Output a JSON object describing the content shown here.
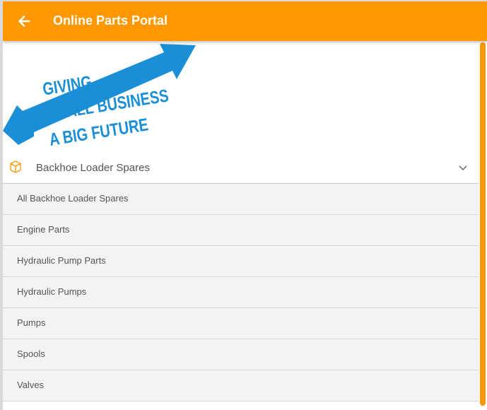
{
  "header": {
    "title": "Online Parts Portal",
    "back_icon": "arrow-left-icon",
    "color": "#ff9800"
  },
  "banner": {
    "lines": [
      "GIVING",
      "SMALL BUSINESS",
      "A BIG FUTURE"
    ],
    "arrow_color": "#1a8fd8"
  },
  "category": {
    "icon": "box-icon",
    "label": "Backhoe Loader Spares",
    "expand_icon": "chevron-down-icon"
  },
  "subcategories": [
    "All Backhoe Loader Spares",
    "Engine Parts",
    "Hydraulic Pump Parts",
    "Hydraulic Pumps",
    "Pumps",
    "Spools",
    "Valves"
  ]
}
